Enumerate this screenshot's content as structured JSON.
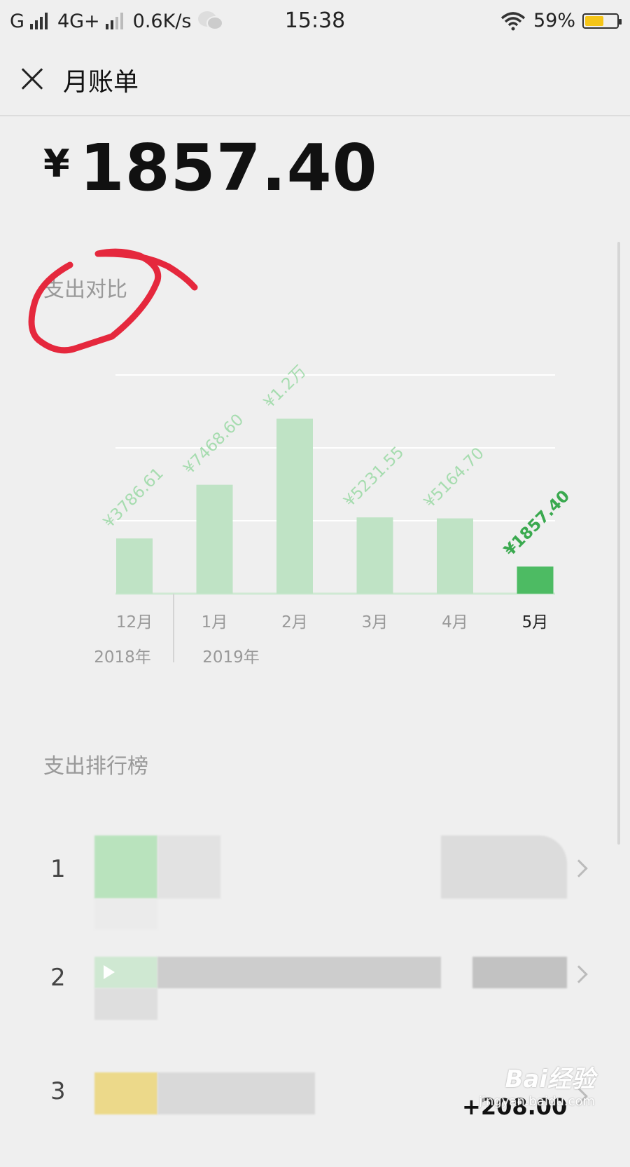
{
  "status_bar": {
    "carrier1": "G",
    "carrier2": "4G+",
    "speed": "0.6K/s",
    "time": "15:38",
    "battery": "59%",
    "battery_level": 0.59,
    "icons": [
      "signal-icon",
      "wechat-icon",
      "wifi-icon",
      "battery-icon"
    ]
  },
  "nav": {
    "title": "月账单",
    "close_icon": "close-icon"
  },
  "summary": {
    "currency": "¥",
    "amount": "1857.40"
  },
  "comparison": {
    "title": "支出对比"
  },
  "chart_data": {
    "type": "bar",
    "categories": [
      "12月",
      "1月",
      "2月",
      "3月",
      "4月",
      "5月"
    ],
    "values": [
      3786.61,
      7468.6,
      12000,
      5231.55,
      5164.7,
      1857.4
    ],
    "value_labels": [
      "¥3786.61",
      "¥7468.60",
      "¥1.2万",
      "¥5231.55",
      "¥5164.70",
      "¥1857.40"
    ],
    "year_labels": [
      "2018年",
      "2019年"
    ],
    "highlight_index": 5,
    "ylim": [
      0,
      15000
    ],
    "grid": true,
    "colors": {
      "bar": "#bfe3c5",
      "bar_current": "#4dbb63",
      "label": "#a6dcaf",
      "label_current": "#3aa94f"
    }
  },
  "ranking": {
    "title": "支出排行榜",
    "rows": [
      {
        "rank": "1",
        "amount": ""
      },
      {
        "rank": "2",
        "amount": ""
      },
      {
        "rank": "3",
        "amount": "+208.00"
      }
    ]
  },
  "watermark": {
    "top": "Bai经验",
    "bottom": "jingyan.baidu.com"
  }
}
